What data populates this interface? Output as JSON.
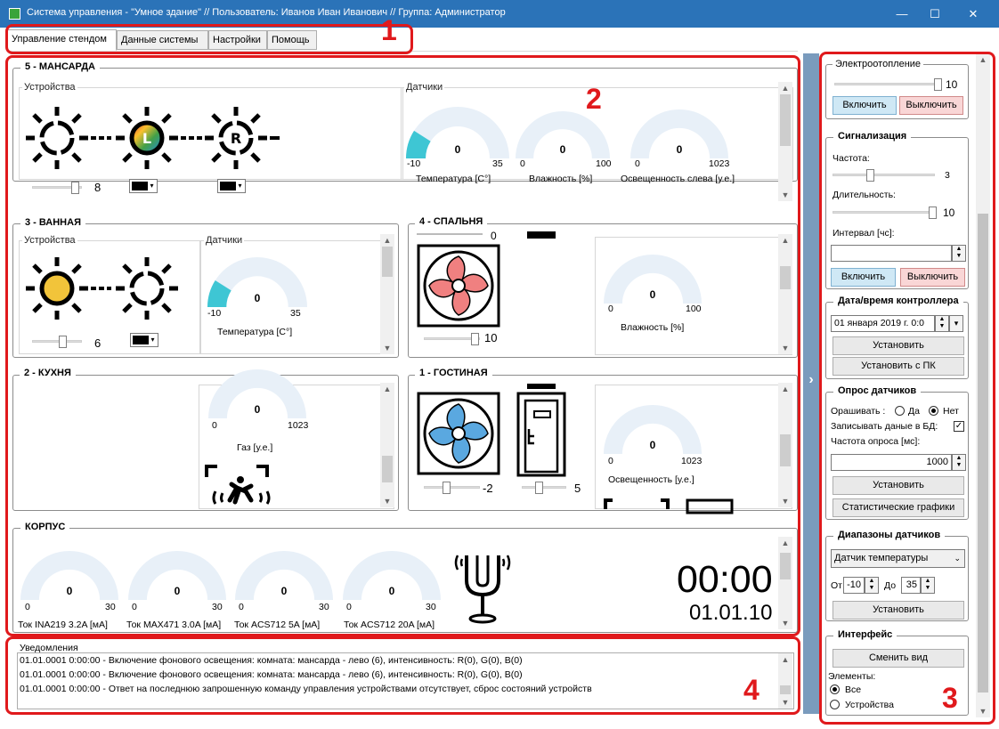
{
  "window": {
    "title": "Система управления - \"Умное здание\" // Пользователь: Иванов Иван Иванович // Группа: Администратор",
    "minimize": "—",
    "maximize": "☐",
    "close": "✕"
  },
  "tabs": [
    "Управление стендом",
    "Данные системы",
    "Настройки",
    "Помощь"
  ],
  "markers": [
    "1",
    "2",
    "3",
    "4"
  ],
  "colors": {
    "title_bar": "#2b73b8",
    "gauge_fill": "#3ec6d4",
    "gauge_track": "#e8f0f8",
    "marker": "#e0191c"
  },
  "mansarda": {
    "title": "5 - МАНСАРДА",
    "devices_title": "Устройства",
    "sensors_title": "Датчики",
    "lamp_letters": [
      "L",
      "R"
    ],
    "slider_value": "8",
    "gauges": [
      {
        "value": "0",
        "min": "-10",
        "max": "35",
        "label": "Температура [C°]",
        "fill": 0.18
      },
      {
        "value": "0",
        "min": "0",
        "max": "100",
        "label": "Влажность [%]",
        "fill": 0
      },
      {
        "value": "0",
        "min": "0",
        "max": "1023",
        "label": "Освещенность слева [у.е.]",
        "fill": 0
      }
    ]
  },
  "vannaya": {
    "title": "3 - ВАННАЯ",
    "devices_title": "Устройства",
    "sensors_title": "Датчики",
    "slider_value": "6",
    "gauge": {
      "value": "0",
      "min": "-10",
      "max": "35",
      "label": "Температура [C°]",
      "fill": 0.18
    }
  },
  "spalnya": {
    "title": "4 - СПАЛЬНЯ",
    "top_value": "0",
    "slider_value": "10",
    "gauge": {
      "value": "0",
      "min": "0",
      "max": "100",
      "label": "Влажность [%]",
      "fill": 0
    }
  },
  "kuhnya": {
    "title": "2 - КУХНЯ",
    "gauge": {
      "value": "0",
      "min": "0",
      "max": "1023",
      "label": "Газ [у.е.]",
      "fill": 0
    }
  },
  "gostinaya": {
    "title": "1 - ГОСТИНАЯ",
    "fan_slider_value": "-2",
    "door_slider_value": "5",
    "gauge": {
      "value": "0",
      "min": "0",
      "max": "1023",
      "label": "Освещенность [у.е.]",
      "fill": 0
    }
  },
  "korpus": {
    "title": "КОРПУС",
    "gauges": [
      {
        "value": "0",
        "min": "0",
        "max": "30",
        "label": "Ток INA219 3.2A [мА]",
        "fill": 0
      },
      {
        "value": "0",
        "min": "0",
        "max": "30",
        "label": "Ток MAX471 3.0A [мА]",
        "fill": 0
      },
      {
        "value": "0",
        "min": "0",
        "max": "30",
        "label": "Ток ACS712 5A [мА]",
        "fill": 0
      },
      {
        "value": "0",
        "min": "0",
        "max": "30",
        "label": "Ток ACS712 20A [мА]",
        "fill": 0
      }
    ],
    "clock_time": "00:00",
    "clock_date": "01.01.10"
  },
  "notifications": {
    "title": "Уведомления",
    "lines": [
      "01.01.0001 0:00:00 - Включение фонового освещения: комната: мансарда - лево (6), интенсивность: R(0), G(0), B(0)",
      "01.01.0001 0:00:00 - Включение фонового освещения: комната: мансарда - лево (6), интенсивность: R(0), G(0), B(0)",
      "01.01.0001 0:00:00 - Ответ на последнюю запрошенную команду управления устройствами отсутствует, сброс состояний устройств"
    ]
  },
  "collapse_arrow": "›",
  "right": {
    "heating": {
      "title": "Электроотопление",
      "value": "10",
      "on": "Включить",
      "off": "Выключить"
    },
    "alarm": {
      "title": "Сигнализация",
      "freq_label": "Частота:",
      "freq_value": "3",
      "dur_label": "Длительность:",
      "dur_value": "10",
      "interval_label": "Интервал [чс]:",
      "interval_value": "",
      "on": "Включить",
      "off": "Выключить"
    },
    "datetime": {
      "title": "Дата/время контроллера",
      "value": "01 января 2019 г. 0:0",
      "set": "Установить",
      "set_pc": "Установить с ПК"
    },
    "poll": {
      "title": "Опрос датчиков",
      "ask_label": "Орашивать :",
      "yes": "Да",
      "no": "Нет",
      "db_label": "Записывать даные в БД:",
      "freq_label": "Частота опроса [мс]:",
      "freq_value": "1000",
      "set": "Установить",
      "charts": "Статистические графики"
    },
    "ranges": {
      "title": "Диапазоны датчиков",
      "sensor": "Датчик температуры",
      "from_label": "От",
      "from": "-10",
      "to_label": "До",
      "to": "35",
      "set": "Установить"
    },
    "iface": {
      "title": "Интерфейс",
      "change_view": "Сменить вид",
      "elements_label": "Элементы:",
      "all": "Все",
      "devices": "Устройства"
    }
  }
}
